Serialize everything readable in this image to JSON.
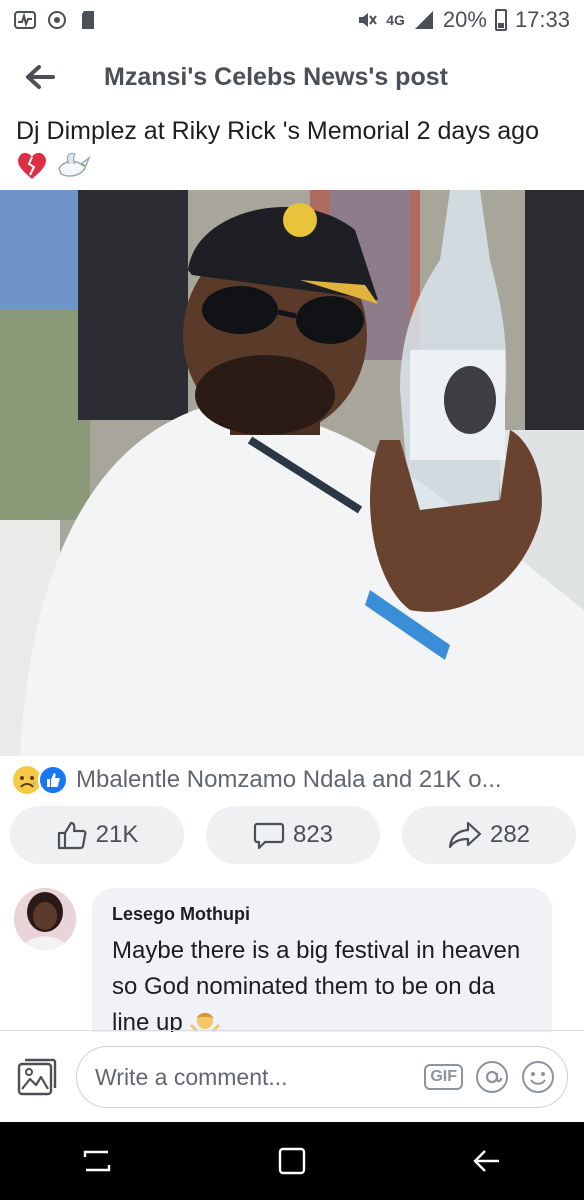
{
  "status_bar": {
    "network": "4G",
    "battery": "20%",
    "time": "17:33"
  },
  "header": {
    "title": "Mzansi's Celebs News's post",
    "back_icon": "arrow-left-icon"
  },
  "post": {
    "text": "Dj Dimplez at Riky Rick 's Memorial 2 days ago",
    "emojis": [
      "broken-heart-icon",
      "dove-icon"
    ]
  },
  "reactions": {
    "icons": [
      "sad-face-icon",
      "like-icon"
    ],
    "summary": "Mbalentle Nomzamo Ndala and 21K o..."
  },
  "actions": {
    "like_count": "21K",
    "comment_count": "823",
    "share_count": "282"
  },
  "comment": {
    "author": "Lesego Mothupi",
    "text": "Maybe there is a big festival in heaven so God nominated them to be on da line up"
  },
  "composer": {
    "placeholder": "Write a comment...",
    "gif_label": "GIF"
  },
  "colors": {
    "accent": "#1877f2",
    "pill_bg": "#eef0f2",
    "bubble_bg": "#f0f2f5",
    "text_secondary": "#606770"
  }
}
